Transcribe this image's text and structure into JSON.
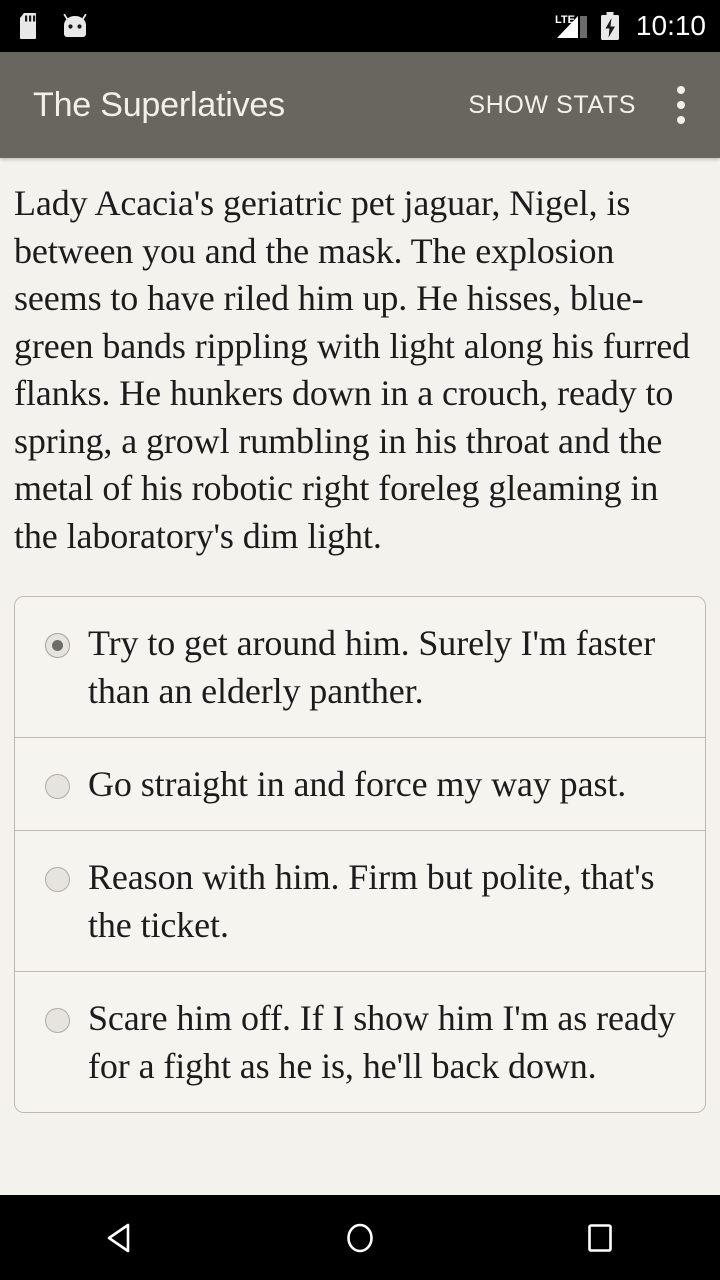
{
  "status_bar": {
    "icons_left": [
      "sd-card-icon",
      "android-head-icon"
    ],
    "network_label": "LTE",
    "icons_right": [
      "lte-signal-icon",
      "battery-charging-icon"
    ],
    "time": "10:10"
  },
  "app_bar": {
    "title": "The Superlatives",
    "show_stats_label": "SHOW STATS",
    "overflow_icon": "more-vert-icon",
    "background_color": "#68665f",
    "text_color": "#f2f0ea"
  },
  "story": {
    "text": "Lady Acacia's geriatric pet jaguar, Nigel, is between you and the mask. The explosion seems to have riled him up. He hisses, blue-green bands rippling with light along his furred flanks. He hunkers down in a crouch, ready to spring, a growl rumbling in his throat and the metal of his robotic right foreleg gleaming in the laboratory's dim light."
  },
  "choices": [
    {
      "label": "Try to get around him. Surely I'm faster than an elderly panther.",
      "selected": true
    },
    {
      "label": "Go straight in and force my way past.",
      "selected": false
    },
    {
      "label": "Reason with him. Firm but polite, that's the ticket.",
      "selected": false
    },
    {
      "label": "Scare him off. If I show him I'm as ready for a fight as he is, he'll back down.",
      "selected": false
    }
  ],
  "nav_bar": {
    "back_icon": "back-triangle-icon",
    "home_icon": "home-circle-icon",
    "recents_icon": "recents-square-icon"
  },
  "colors": {
    "page_background": "#f4f2ed",
    "card_background": "#f6f4ef",
    "card_border": "#bdb9b1",
    "body_text": "#1c1c1c"
  }
}
